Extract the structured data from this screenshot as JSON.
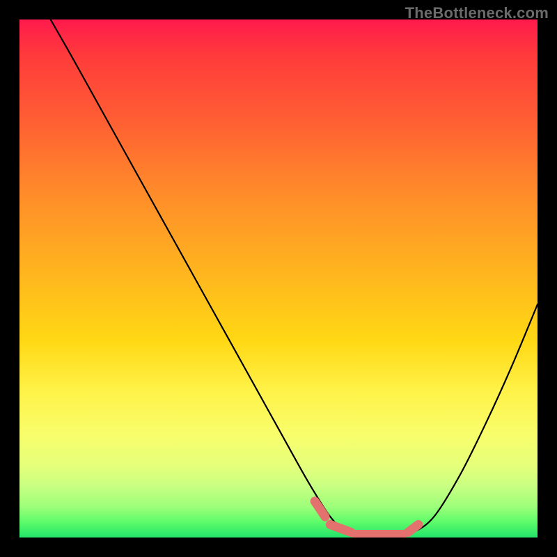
{
  "watermark": "TheBottleneck.com",
  "chart_data": {
    "type": "line",
    "title": "",
    "xlabel": "",
    "ylabel": "",
    "xlim": [
      0,
      100
    ],
    "ylim": [
      0,
      100
    ],
    "grid": false,
    "legend": false,
    "annotations": [],
    "series": [
      {
        "name": "bottleneck-curve",
        "x": [
          6,
          10,
          15,
          20,
          25,
          30,
          35,
          40,
          45,
          50,
          55,
          58,
          60,
          62,
          65,
          68,
          70,
          73,
          76,
          80,
          85,
          90,
          95,
          100
        ],
        "y": [
          100,
          93,
          84,
          75,
          66,
          57,
          48,
          39,
          30,
          21,
          12,
          7,
          4,
          2,
          1,
          0.5,
          0.5,
          0.5,
          1,
          4,
          12,
          22,
          33,
          45
        ]
      }
    ],
    "markers": {
      "name": "flat-region-markers",
      "color": "#e3716e",
      "segments": [
        {
          "x0": 57,
          "y0": 7,
          "x1": 59,
          "y1": 4
        },
        {
          "x0": 60,
          "y0": 2.5,
          "x1": 64,
          "y1": 1
        },
        {
          "x0": 65,
          "y0": 0.6,
          "x1": 74,
          "y1": 0.6
        },
        {
          "x0": 75,
          "y0": 1,
          "x1": 77,
          "y1": 2.5
        }
      ]
    },
    "background_gradient": {
      "stops": [
        {
          "pos": 0,
          "color": "#ff1a4d"
        },
        {
          "pos": 7,
          "color": "#ff3b3b"
        },
        {
          "pos": 18,
          "color": "#ff5a34"
        },
        {
          "pos": 33,
          "color": "#ff8a2a"
        },
        {
          "pos": 48,
          "color": "#ffb31f"
        },
        {
          "pos": 62,
          "color": "#ffd814"
        },
        {
          "pos": 72,
          "color": "#fff34a"
        },
        {
          "pos": 80,
          "color": "#f8fd6a"
        },
        {
          "pos": 86,
          "color": "#e6ff7a"
        },
        {
          "pos": 90,
          "color": "#c9ff82"
        },
        {
          "pos": 94,
          "color": "#9eff7a"
        },
        {
          "pos": 97,
          "color": "#5dfb6a"
        },
        {
          "pos": 100,
          "color": "#22e56a"
        }
      ]
    }
  }
}
